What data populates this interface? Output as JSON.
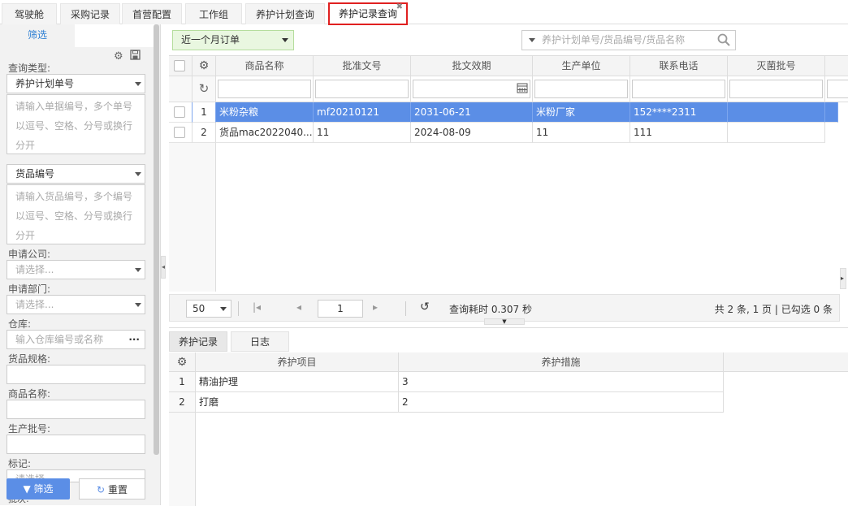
{
  "tabs": [
    {
      "label": "驾驶舱"
    },
    {
      "label": "采购记录"
    },
    {
      "label": "首营配置"
    },
    {
      "label": "工作组"
    },
    {
      "label": "养护计划查询"
    },
    {
      "label": "养护记录查询"
    }
  ],
  "sidebar": {
    "tab_label": "筛选",
    "query_type_label": "查询类型:",
    "query_type_value": "养护计划单号",
    "query_type_placeholder": "请输入单据编号，多个单号以逗号、空格、分号或换行分开",
    "goods_select_value": "货品编号",
    "goods_placeholder": "请输入货品编号，多个编号以逗号、空格、分号或换行分开",
    "company_label": "申请公司:",
    "company_placeholder": "请选择...",
    "dept_label": "申请部门:",
    "dept_placeholder": "请选择...",
    "warehouse_label": "仓库:",
    "warehouse_placeholder": "输入仓库编号或名称",
    "warehouse_more": "···",
    "spec_label": "货品规格:",
    "goods_name_label": "商品名称:",
    "batch_label": "生产批号:",
    "mark_label": "标记:",
    "mark_placeholder": "请选择...",
    "next_label": "批次:",
    "filter_button": "筛选",
    "reset_button": "重置"
  },
  "toolbar": {
    "period": "近一个月订单",
    "search_placeholder": "养护计划单号/货品编号/货品名称"
  },
  "grid": {
    "columns": [
      "商品名称",
      "批准文号",
      "批文效期",
      "生产单位",
      "联系电话",
      "灭菌批号"
    ],
    "rows": [
      {
        "no": "1",
        "cells": [
          "米粉杂粮",
          "mf20210121",
          "2031-06-21",
          "米粉厂家",
          "152****2311",
          ""
        ]
      },
      {
        "no": "2",
        "cells": [
          "货品mac2022040...",
          "11",
          "2024-08-09",
          "11",
          "111",
          ""
        ]
      }
    ]
  },
  "pager": {
    "page_size": "50",
    "current_page": "1",
    "elapsed": "查询耗时 0.307 秒",
    "summary": "共 2 条, 1 页 | 已勾选 0 条"
  },
  "detail": {
    "tabs": [
      {
        "label": "养护记录"
      },
      {
        "label": "日志"
      }
    ],
    "columns": [
      "养护项目",
      "养护措施"
    ],
    "rows": [
      {
        "no": "1",
        "item": "精油护理",
        "measure": "3"
      },
      {
        "no": "2",
        "item": "打磨",
        "measure": "2"
      }
    ]
  },
  "colors": {
    "accent": "#2d7fd3",
    "selected_row": "#5b8ee6",
    "active_tab_border": "#e02020",
    "period_bg": "#e9f7e0"
  }
}
